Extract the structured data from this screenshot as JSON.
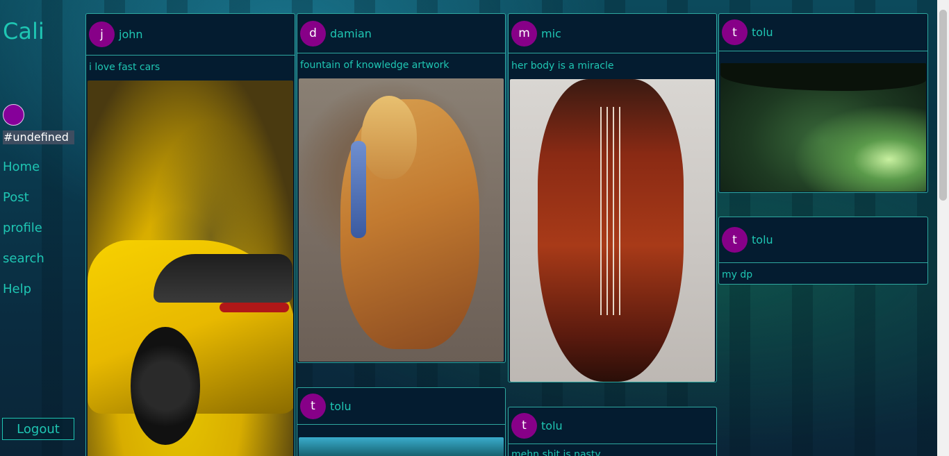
{
  "app": {
    "brand": "Cali",
    "username_tag": "#undefined",
    "accent_color": "#1fc6b3",
    "avatar_color": "#870088"
  },
  "sidebar": {
    "items": [
      {
        "label": "Home"
      },
      {
        "label": "Post"
      },
      {
        "label": "profile"
      },
      {
        "label": "search"
      },
      {
        "label": "Help"
      }
    ],
    "logout_label": "Logout"
  },
  "posts": [
    {
      "initial": "j",
      "user": "john",
      "caption": "i love fast cars",
      "image": "yellow sports car"
    },
    {
      "initial": "d",
      "user": "damian",
      "caption": "fountain of knowledge artwork",
      "image": "mother and child painting"
    },
    {
      "initial": "m",
      "user": "mic",
      "caption": "her body is a miracle",
      "image": "woman violin painting"
    },
    {
      "initial": "t",
      "user": "tolu",
      "caption": "",
      "image": "dark green forest"
    },
    {
      "initial": "t",
      "user": "tolu",
      "caption": "my dp",
      "image": ""
    },
    {
      "initial": "t",
      "user": "tolu",
      "caption": "",
      "image": "blue lagoon forest"
    },
    {
      "initial": "t",
      "user": "tolu",
      "caption": "mehn shit is nasty",
      "image": ""
    }
  ]
}
